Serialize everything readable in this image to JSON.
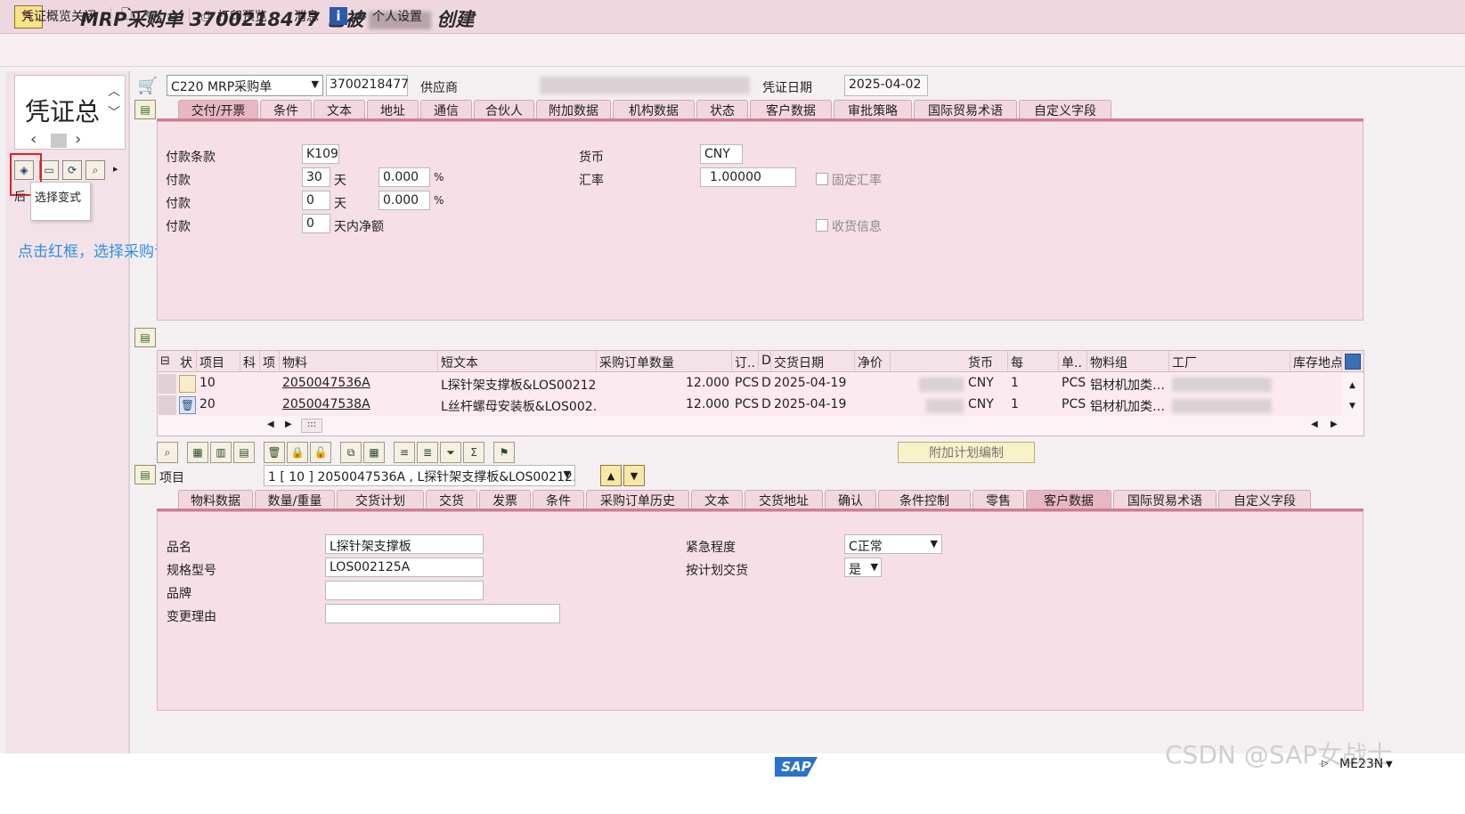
{
  "window": {
    "title_prefix": "MRP采购单 3700218477 已被",
    "title_suffix": "创建"
  },
  "menubar": {
    "close_overview": "凭证概览关闭",
    "print_preview": "打印预览",
    "messages": "消息",
    "personal_settings": "个人设置"
  },
  "overview": {
    "label": "凭证总",
    "tooltip": "选择变式",
    "tooltip_stub": "后",
    "annotation": "点击红框，选择采购订单"
  },
  "header": {
    "doc_type": "C220 MRP采购单",
    "doc_number": "3700218477",
    "vendor_label": "供应商",
    "doc_date_label": "凭证日期",
    "doc_date": "2025-04-02"
  },
  "header_tabs": [
    "交付/开票",
    "条件",
    "文本",
    "地址",
    "通信",
    "合伙人",
    "附加数据",
    "机构数据",
    "状态",
    "客户数据",
    "审批策略",
    "国际贸易术语",
    "自定义字段"
  ],
  "payment": {
    "terms_label": "付款条款",
    "terms_value": "K109",
    "rows": [
      {
        "label": "付款",
        "days": "30",
        "unit": "天",
        "pct": "0.000",
        "pct_sign": "%"
      },
      {
        "label": "付款",
        "days": "0",
        "unit": "天",
        "pct": "0.000",
        "pct_sign": "%"
      },
      {
        "label": "付款",
        "days": "0",
        "unit": "天内净额"
      }
    ],
    "currency_label": "货币",
    "currency_value": "CNY",
    "rate_label": "汇率",
    "rate_value": "1.00000",
    "fixed_rate_label": "固定汇率",
    "gr_info_label": "收货信息"
  },
  "items_table": {
    "headers": [
      "状",
      "项目",
      "科",
      "项",
      "物料",
      "短文本",
      "采购订单数量",
      "订..",
      "D",
      "交货日期",
      "净价",
      "货币",
      "每",
      "单..",
      "物料组",
      "工厂",
      "库存地点"
    ],
    "rows": [
      {
        "item": "10",
        "material": "2050047536A",
        "short_text": "L探针架支撑板&LOS00212…",
        "qty": "12.000",
        "unit": "PCS",
        "d": "D",
        "date": "2025-04-19",
        "currency": "CNY",
        "per": "1",
        "unit2": "PCS",
        "mat_group": "铝材机加类…"
      },
      {
        "item": "20",
        "material": "2050047538A",
        "short_text": "L丝杆螺母安装板&LOS002…",
        "qty": "12.000",
        "unit": "PCS",
        "d": "D",
        "date": "2025-04-19",
        "currency": "CNY",
        "per": "1",
        "unit2": "PCS",
        "mat_group": "铝材机加类…"
      }
    ],
    "scroll_mid": ":::"
  },
  "item_toolbar": {
    "extra_plan": "附加计划编制"
  },
  "item_detail": {
    "item_label": "项目",
    "item_select": "1 [ 10 ] 2050047536A , L探针架支撑板&LOS00212…"
  },
  "item_tabs": [
    "物料数据",
    "数量/重量",
    "交货计划",
    "交货",
    "发票",
    "条件",
    "采购订单历史",
    "文本",
    "交货地址",
    "确认",
    "条件控制",
    "零售",
    "客户数据",
    "国际贸易术语",
    "自定义字段"
  ],
  "customer_data": {
    "name_label": "品名",
    "name_value": "L探针架支撑板",
    "spec_label": "规格型号",
    "spec_value": "LOS002125A",
    "brand_label": "品牌",
    "brand_value": "",
    "reason_label": "变更理由",
    "reason_value": "",
    "urgency_label": "紧急程度",
    "urgency_value": "C正常",
    "plan_label": "按计划交货",
    "plan_value": "是"
  },
  "footer": {
    "sap": "SAP",
    "tcode": "ME23N",
    "watermark": "CSDN @SAP女战士"
  }
}
